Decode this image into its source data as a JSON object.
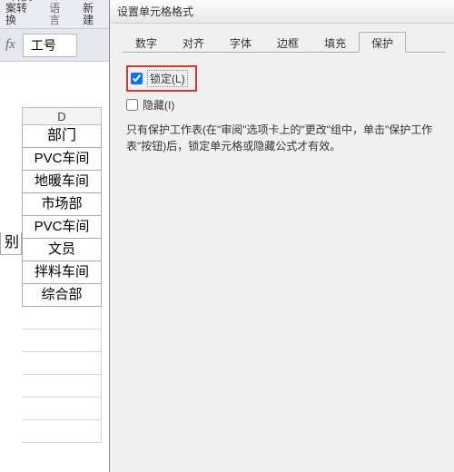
{
  "ribbon": {
    "group1a": "转换",
    "group1b": "案转换",
    "group2a": "翻译",
    "group2_label": "语言",
    "group3a": "新建"
  },
  "formula_bar": {
    "fx": "fx",
    "name_value": "工号"
  },
  "sheet": {
    "col_letter": "D",
    "left_partial_header": "别",
    "header": "部门",
    "rows": [
      "PVC车间",
      "地暖车间",
      "市场部",
      "PVC车间",
      "文员",
      "拌料车间",
      "综合部"
    ]
  },
  "dialog": {
    "title": "设置单元格格式",
    "tabs": [
      "数字",
      "对齐",
      "字体",
      "边框",
      "填充",
      "保护"
    ],
    "active_tab_index": 5,
    "lock_label": "锁定(L)",
    "hide_label": "隐藏(I)",
    "hint_text": "只有保护工作表(在\"审阅\"选项卡上的\"更改\"组中，单击\"保护工作表\"按钮)后，锁定单元格或隐藏公式才有效。"
  }
}
